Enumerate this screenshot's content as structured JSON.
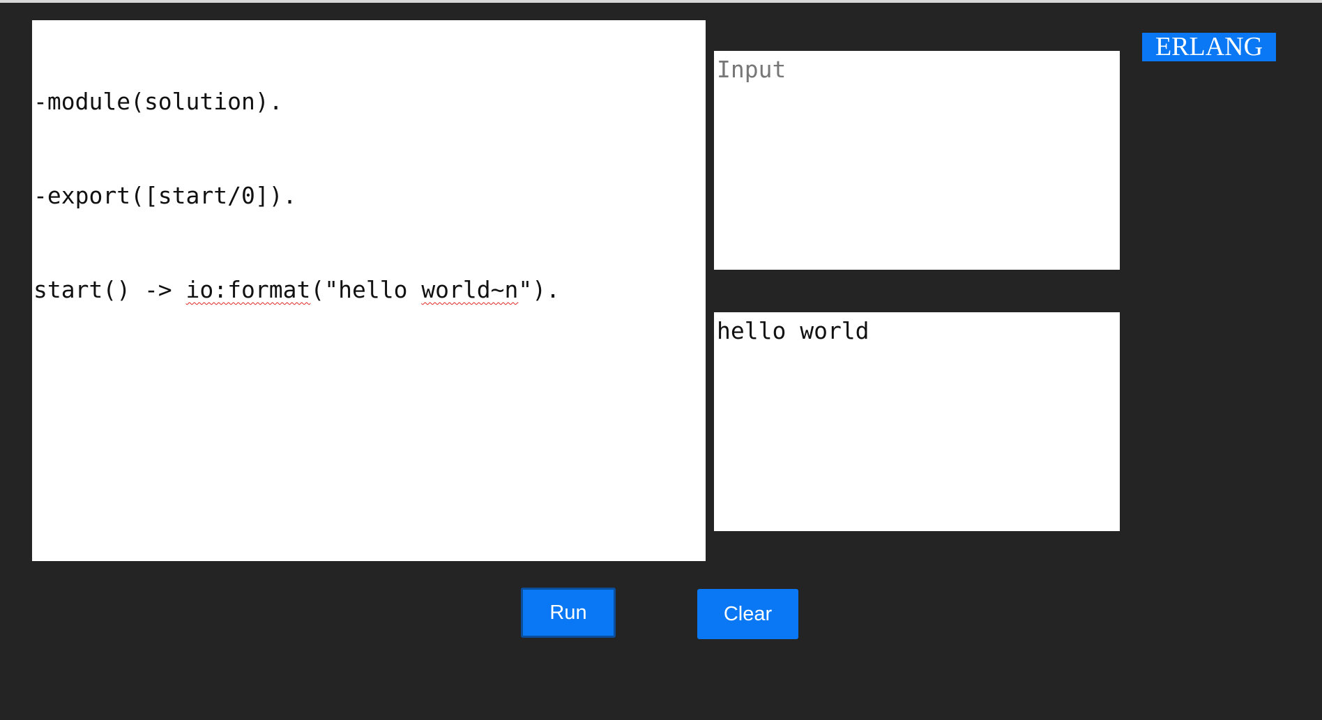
{
  "editor": {
    "lines": [
      {
        "before": "-module(solution).",
        "spell1": "",
        "mid": "",
        "spell2": "",
        "after": ""
      },
      {
        "before": "-export([start/0]).",
        "spell1": "",
        "mid": "",
        "spell2": "",
        "after": ""
      },
      {
        "before": "start() -> ",
        "spell1": "io:format",
        "mid": "(\"hello ",
        "spell2": "world~n",
        "after": "\")."
      }
    ]
  },
  "input": {
    "placeholder": "Input",
    "value": ""
  },
  "output": {
    "text": "hello world"
  },
  "language_badge": "ERLANG",
  "buttons": {
    "run_label": "Run",
    "clear_label": "Clear"
  },
  "colors": {
    "background": "#242424",
    "accent": "#0a78f5"
  }
}
